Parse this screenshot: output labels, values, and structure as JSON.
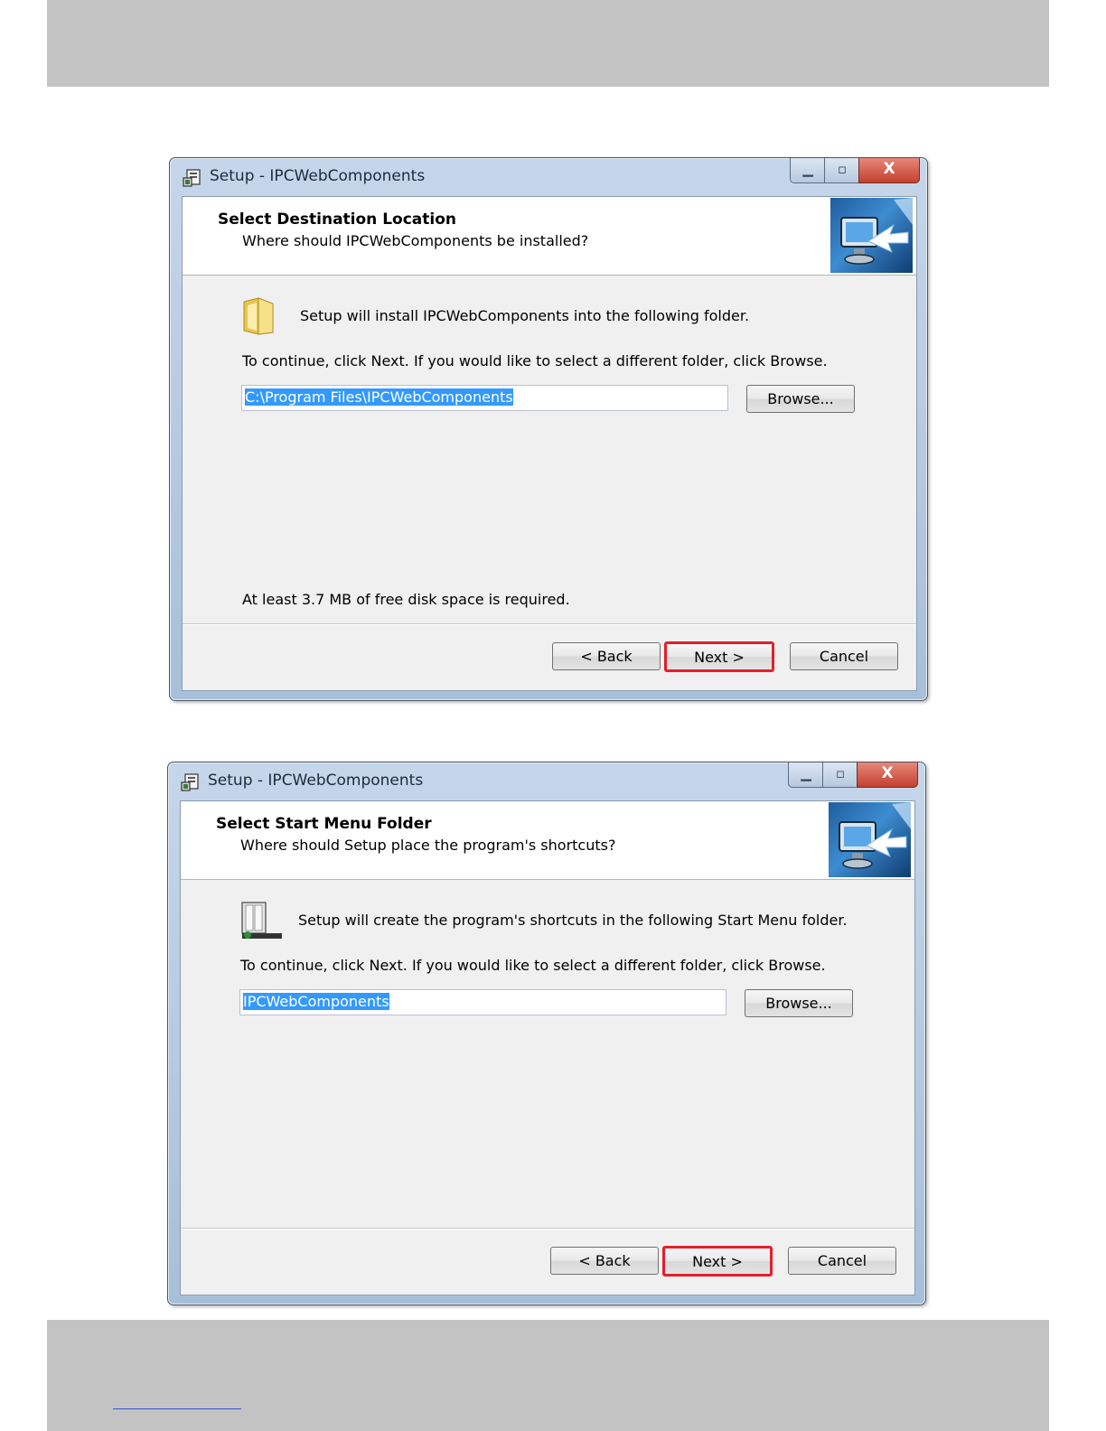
{
  "dialogs": [
    {
      "window_title": "Setup - IPCWebComponents",
      "header_title": "Select Destination Location",
      "header_subtitle": "Where should IPCWebComponents be installed?",
      "install_text": "Setup will install IPCWebComponents into the following folder.",
      "continue_text": "To continue, click Next. If you would like to select a different folder, click Browse.",
      "path_value": "C:\\Program Files\\IPCWebComponents",
      "browse_label": "Browse...",
      "disk_space_text": "At least 3.7 MB of free disk space is required.",
      "back_label": "< Back",
      "next_label": "Next >",
      "cancel_label": "Cancel",
      "close_glyph": "X"
    },
    {
      "window_title": "Setup - IPCWebComponents",
      "header_title": "Select Start Menu Folder",
      "header_subtitle": "Where should Setup place the program's shortcuts?",
      "install_text": "Setup will create the program's shortcuts in the following Start Menu folder.",
      "continue_text": "To continue, click Next. If you would like to select a different folder, click Browse.",
      "path_value": "IPCWebComponents",
      "browse_label": "Browse...",
      "back_label": "< Back",
      "next_label": "Next >",
      "cancel_label": "Cancel",
      "close_glyph": "X"
    }
  ],
  "colors": {
    "highlight_border": "#e3202a",
    "selection": "#3399ff",
    "page_band": "#c3c3c3"
  }
}
